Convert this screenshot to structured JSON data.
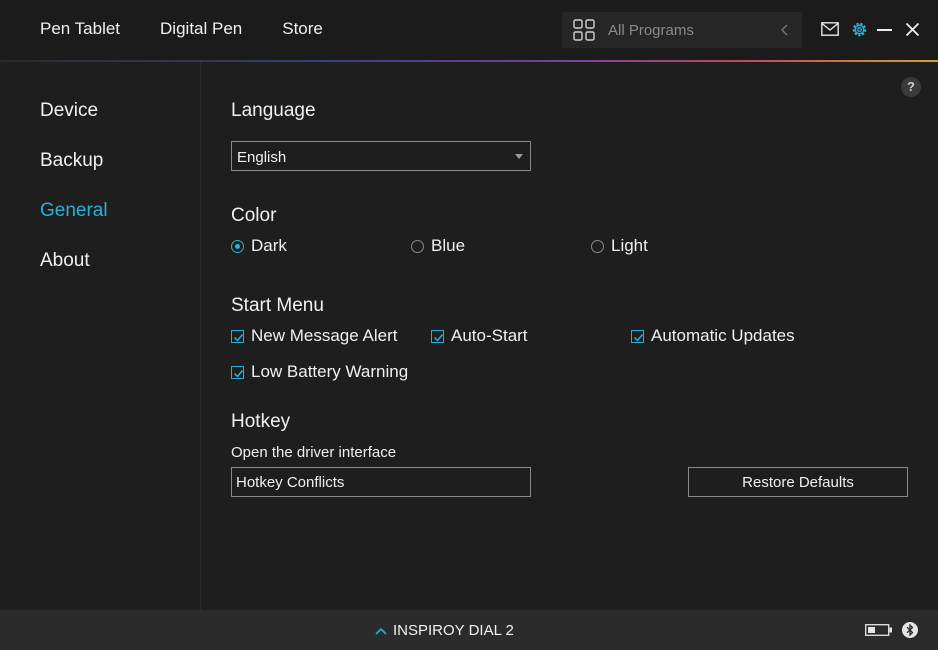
{
  "top_nav": {
    "items": [
      "Pen Tablet",
      "Digital Pen",
      "Store"
    ]
  },
  "programs": {
    "label": "All Programs"
  },
  "sidebar": {
    "items": [
      "Device",
      "Backup",
      "General",
      "About"
    ],
    "active": "General"
  },
  "general": {
    "language": {
      "title": "Language",
      "value": "English"
    },
    "color": {
      "title": "Color",
      "options": [
        "Dark",
        "Blue",
        "Light"
      ],
      "selected": "Dark"
    },
    "start_menu": {
      "title": "Start Menu",
      "options": [
        "New Message Alert",
        "Auto-Start",
        "Automatic Updates",
        "Low Battery Warning"
      ],
      "checked": [
        true,
        true,
        true,
        true
      ]
    },
    "hotkey": {
      "title": "Hotkey",
      "subtitle": "Open the driver interface",
      "value": "Hotkey Conflicts",
      "restore_label": "Restore Defaults"
    }
  },
  "status": {
    "device": "INSPIROY DIAL 2"
  },
  "colors": {
    "accent": "#2ab0d8",
    "background": "#1e1e1e",
    "bottom_bar": "#2b2b2b"
  },
  "icons": [
    "grid-icon",
    "chevron-left-icon",
    "mail-icon",
    "gear-icon",
    "minimize-icon",
    "close-icon",
    "help-icon",
    "chevron-up-icon",
    "battery-icon",
    "bluetooth-icon"
  ]
}
